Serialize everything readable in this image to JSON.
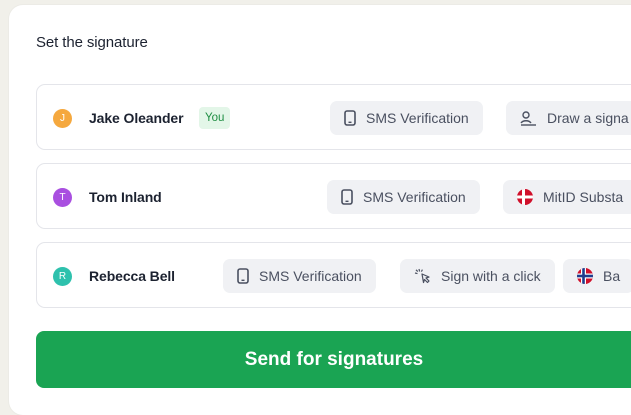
{
  "title": "Set the signature",
  "signers": [
    {
      "initial": "J",
      "name": "Jake Oleander",
      "avatar_color": "#f5a83e",
      "badge": "You",
      "methods": [
        {
          "label": "SMS Verification",
          "icon": "phone-icon"
        },
        {
          "label": "Draw a signa",
          "icon": "draw-signature-icon"
        }
      ]
    },
    {
      "initial": "T",
      "name": "Tom Inland",
      "avatar_color": "#a94fe0",
      "methods": [
        {
          "label": "SMS Verification",
          "icon": "phone-icon"
        },
        {
          "label": "MitID Substa",
          "icon": "denmark-flag-icon"
        }
      ]
    },
    {
      "initial": "R",
      "name": "Rebecca Bell",
      "avatar_color": "#2ec1ad",
      "methods": [
        {
          "label": "SMS Verification",
          "icon": "phone-icon"
        },
        {
          "label": "Sign with a click",
          "icon": "click-icon"
        },
        {
          "label": "Ba",
          "icon": "norway-flag-icon"
        }
      ]
    }
  ],
  "send_label": "Send for signatures",
  "colors": {
    "accent": "#1aa453",
    "badge_bg": "#e3f6e8",
    "badge_text": "#1f8e43"
  }
}
